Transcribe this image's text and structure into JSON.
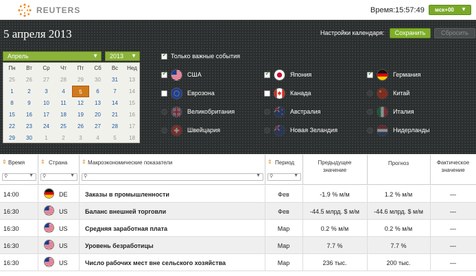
{
  "header": {
    "logo_text": "REUTERS",
    "time_label": "Время:",
    "time_value": "15:57:49",
    "timezone": "мск+00"
  },
  "panel": {
    "date_title": "5 апреля 2013",
    "settings_label": "Настройки календаря:",
    "save_label": "Сохранить",
    "reset_label": "Сбросить"
  },
  "calendar": {
    "month": "Апрель",
    "year": "2013",
    "weekdays": [
      "Пн",
      "Вт",
      "Ср",
      "Чт",
      "Пт",
      "Сб",
      "Вс",
      "Нед"
    ],
    "weeks": [
      [
        "25",
        "26",
        "27",
        "28",
        "29",
        "30",
        "31",
        "13"
      ],
      [
        "1",
        "2",
        "3",
        "4",
        "5",
        "6",
        "7",
        "14"
      ],
      [
        "8",
        "9",
        "10",
        "11",
        "12",
        "13",
        "14",
        "15"
      ],
      [
        "15",
        "16",
        "17",
        "18",
        "19",
        "20",
        "21",
        "16"
      ],
      [
        "22",
        "23",
        "24",
        "25",
        "26",
        "27",
        "28",
        "17"
      ],
      [
        "29",
        "30",
        "1",
        "2",
        "3",
        "4",
        "5",
        "18"
      ]
    ],
    "selected_day": "5"
  },
  "filters": {
    "important_only_label": "Только важные события",
    "important_only_checked": true,
    "countries": [
      {
        "name": "США",
        "checked": true,
        "enabled": true,
        "flag": "us-flag"
      },
      {
        "name": "Япония",
        "checked": true,
        "enabled": true,
        "flag": "jp-flag"
      },
      {
        "name": "Германия",
        "checked": true,
        "enabled": true,
        "flag": "de-flag"
      },
      {
        "name": "Еврозона",
        "checked": false,
        "enabled": true,
        "flag": "eu-flag"
      },
      {
        "name": "Канада",
        "checked": false,
        "enabled": true,
        "flag": "ca-flag"
      },
      {
        "name": "Китай",
        "checked": false,
        "enabled": false,
        "flag": "cn-flag"
      },
      {
        "name": "Великобритания",
        "checked": false,
        "enabled": false,
        "flag": "gb-flag"
      },
      {
        "name": "Австралия",
        "checked": false,
        "enabled": false,
        "flag": "au-flag"
      },
      {
        "name": "Италия",
        "checked": false,
        "enabled": false,
        "flag": "it-flag"
      },
      {
        "name": "Швейцария",
        "checked": false,
        "enabled": false,
        "flag": "ch-flag"
      },
      {
        "name": "Новая Зеландия",
        "checked": false,
        "enabled": false,
        "flag": "nz-flag"
      },
      {
        "name": "Нидерланды",
        "checked": false,
        "enabled": false,
        "flag": "nl-flag"
      }
    ]
  },
  "table": {
    "headers": {
      "time": "Время",
      "country": "Страна",
      "indicator": "Макроэкономические показатели",
      "period": "Период",
      "previous_l1": "Предыдущее",
      "previous_l2": "значение",
      "forecast": "Прогноз",
      "actual_l1": "Фактическое",
      "actual_l2": "значение"
    },
    "rows": [
      {
        "time": "14:00",
        "country": "DE",
        "flag": "de-flag",
        "event": "Заказы в промышленности",
        "period": "Фев",
        "previous": "-1.9 % м/м",
        "forecast": "1.2 % м/м",
        "actual": "—"
      },
      {
        "time": "16:30",
        "country": "US",
        "flag": "us-flag",
        "event": "Баланс внешней торговли",
        "period": "Фев",
        "previous": "-44.5 млрд. $ м/м",
        "forecast": "-44.6 млрд. $ м/м",
        "actual": "—"
      },
      {
        "time": "16:30",
        "country": "US",
        "flag": "us-flag",
        "event": "Средняя заработная плата",
        "period": "Мар",
        "previous": "0.2 % м/м",
        "forecast": "0.2 % м/м",
        "actual": "—"
      },
      {
        "time": "16:30",
        "country": "US",
        "flag": "us-flag",
        "event": "Уровень безработицы",
        "period": "Мар",
        "previous": "7.7 %",
        "forecast": "7.7 %",
        "actual": "—"
      },
      {
        "time": "16:30",
        "country": "US",
        "flag": "us-flag",
        "event": "Число рабочих мест вне сельского хозяйства",
        "period": "Мар",
        "previous": "236 тыс.",
        "forecast": "200 тыс.",
        "actual": "—"
      }
    ]
  }
}
